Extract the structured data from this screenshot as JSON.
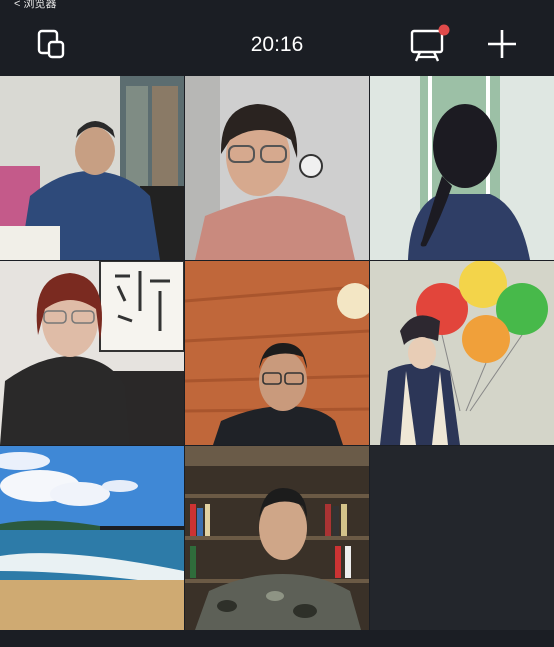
{
  "status_bar": {
    "text": "< 浏览器"
  },
  "header": {
    "time": "20:16",
    "icons": {
      "left": "switch-camera-icon",
      "screen_share": "screen-share-icon",
      "add": "plus-icon"
    },
    "notification_color": "#e04a4a"
  },
  "participants": [
    {
      "id": "p1",
      "description": "man-blue-jacket-library"
    },
    {
      "id": "p2",
      "description": "woman-glasses-pink-shirt"
    },
    {
      "id": "p3",
      "description": "girl-braid-window"
    },
    {
      "id": "p4",
      "description": "woman-glasses-calligraphy"
    },
    {
      "id": "p5",
      "description": "man-glasses-wood-ceiling"
    },
    {
      "id": "p6",
      "description": "girl-balloons-cartoon"
    },
    {
      "id": "p7",
      "description": "beach-scene"
    },
    {
      "id": "p8",
      "description": "man-camo-bookshelf"
    }
  ]
}
